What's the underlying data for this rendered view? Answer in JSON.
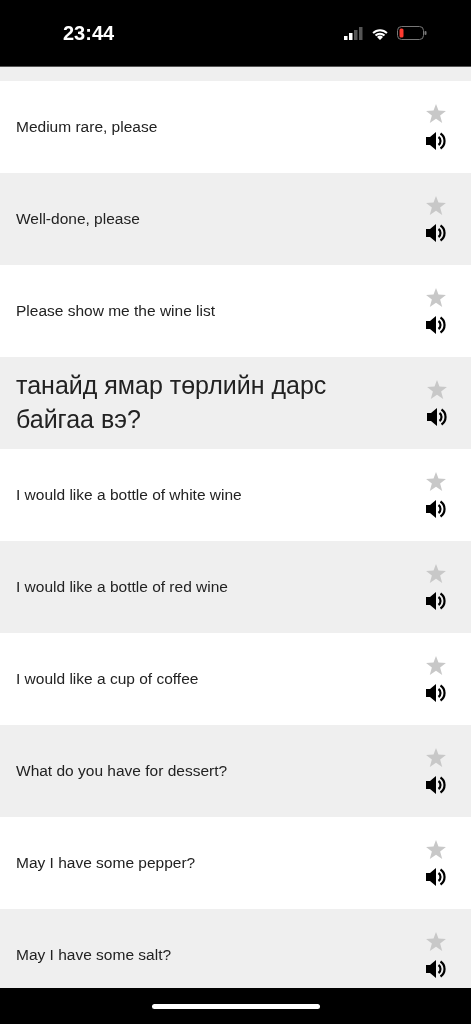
{
  "status_bar": {
    "time": "23:44"
  },
  "phrases": [
    {
      "text": "Medium rare, please",
      "kind": "phrase",
      "favorite": false
    },
    {
      "text": "Well-done, please",
      "kind": "phrase",
      "favorite": false
    },
    {
      "text": "Please show me the wine list",
      "kind": "phrase",
      "favorite": false
    },
    {
      "text": "танайд ямар төрлийн дарс байгаа вэ?",
      "kind": "translation",
      "favorite": false
    },
    {
      "text": "I would like a bottle of white wine",
      "kind": "phrase",
      "favorite": false
    },
    {
      "text": "I would like a bottle of red wine",
      "kind": "phrase",
      "favorite": false
    },
    {
      "text": "I would like a cup of coffee",
      "kind": "phrase",
      "favorite": false
    },
    {
      "text": "What do you have for dessert?",
      "kind": "phrase",
      "favorite": false
    },
    {
      "text": "May I have some pepper?",
      "kind": "phrase",
      "favorite": false
    },
    {
      "text": "May I have some salt?",
      "kind": "phrase",
      "favorite": false
    }
  ]
}
